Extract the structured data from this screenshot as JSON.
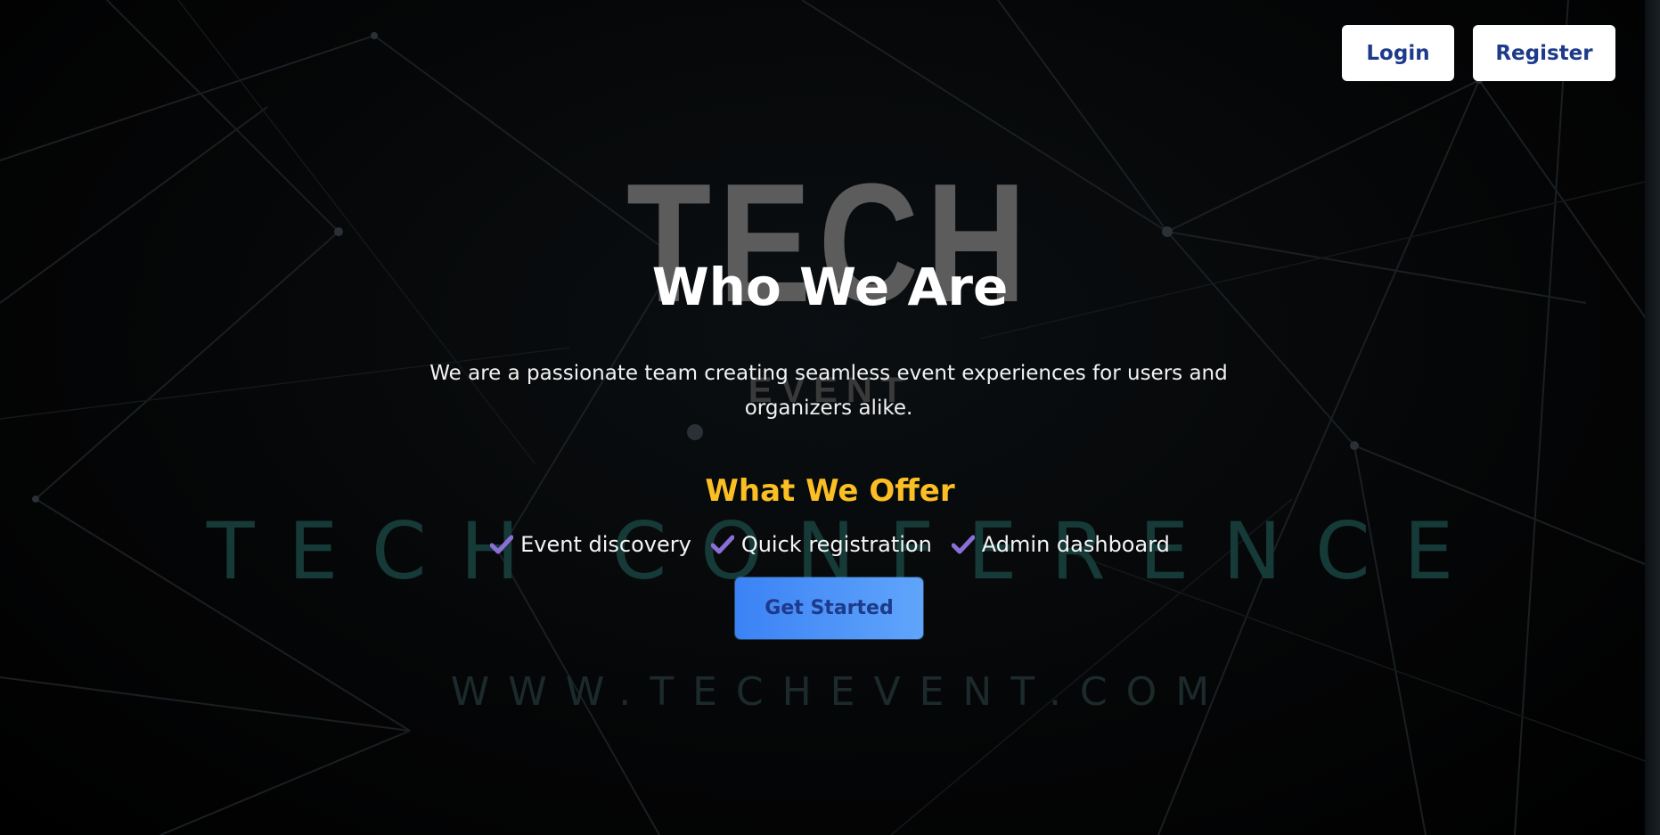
{
  "background": {
    "poster_title": "TECH",
    "poster_subtitle": "EVENT",
    "poster_banner": "TECH CONFERENCE",
    "poster_url": "WWW.TECHEVENT.COM"
  },
  "nav": {
    "login_label": "Login",
    "register_label": "Register"
  },
  "hero": {
    "title": "Who We Are",
    "description": "We are a passionate team creating seamless event experiences for users and organizers alike.",
    "offer_title": "What We Offer",
    "features": [
      {
        "label": "Event discovery",
        "icon": "check-icon"
      },
      {
        "label": "Quick registration",
        "icon": "check-icon"
      },
      {
        "label": "Admin dashboard",
        "icon": "check-icon"
      }
    ],
    "cta_label": "Get Started"
  },
  "colors": {
    "offer_title": "#fbbf24",
    "check": "#8b6fd6",
    "button_text": "#1e3a8a",
    "cta_gradient_start": "#3b82f6",
    "cta_gradient_end": "#60a5fa"
  }
}
